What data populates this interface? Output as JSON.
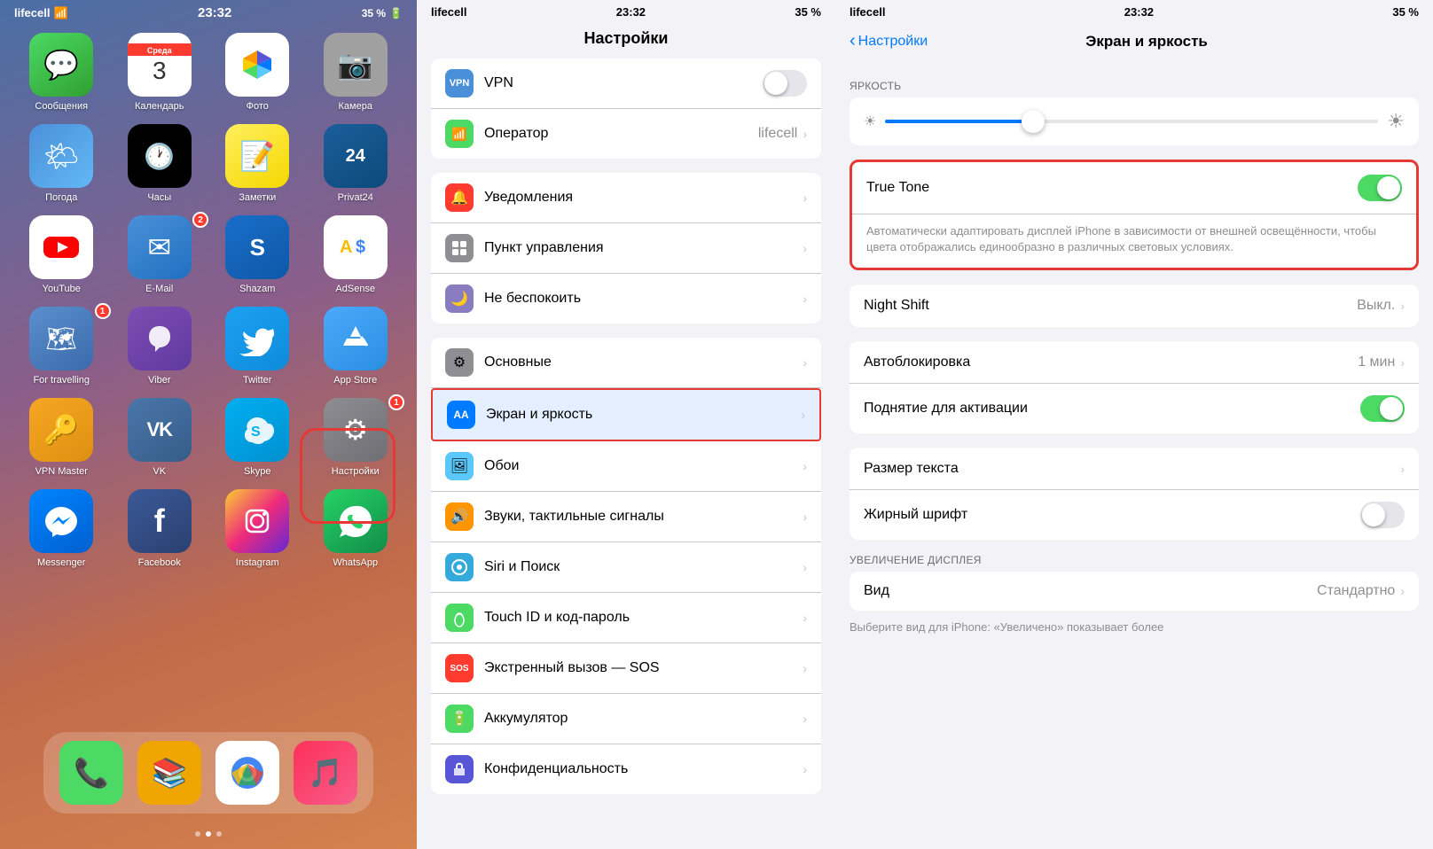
{
  "panel1": {
    "status": {
      "carrier": "lifecell",
      "signal": "📶",
      "wifi": "wifi",
      "time": "23:32",
      "battery": "35 %"
    },
    "apps_row1": [
      {
        "id": "messages",
        "label": "Сообщения",
        "icon": "💬",
        "color": "icon-messages",
        "badge": null
      },
      {
        "id": "calendar",
        "label": "Календарь",
        "icon": "cal",
        "color": "icon-calendar",
        "badge": null
      },
      {
        "id": "photos",
        "label": "Фото",
        "icon": "📷",
        "color": "icon-photos",
        "badge": null
      },
      {
        "id": "camera",
        "label": "Камера",
        "icon": "📸",
        "color": "icon-camera",
        "badge": null
      }
    ],
    "apps_row2": [
      {
        "id": "weather",
        "label": "Погода",
        "icon": "🌤",
        "color": "icon-weather",
        "badge": null
      },
      {
        "id": "clock",
        "label": "Часы",
        "icon": "🕐",
        "color": "icon-clock",
        "badge": null
      },
      {
        "id": "notes",
        "label": "Заметки",
        "icon": "📝",
        "color": "icon-notes",
        "badge": null
      },
      {
        "id": "privat24",
        "label": "Privat24",
        "icon": "24",
        "color": "icon-privat",
        "badge": null
      }
    ],
    "apps_row3": [
      {
        "id": "youtube",
        "label": "YouTube",
        "icon": "▶",
        "color": "icon-youtube",
        "badge": null
      },
      {
        "id": "email",
        "label": "E-Mail",
        "icon": "✉",
        "color": "icon-email",
        "badge": "2"
      },
      {
        "id": "shazam",
        "label": "Shazam",
        "icon": "S",
        "color": "icon-shazam",
        "badge": null
      },
      {
        "id": "adsense",
        "label": "AdSense",
        "icon": "A$",
        "color": "icon-adsense",
        "badge": null
      }
    ],
    "apps_row4": [
      {
        "id": "fortravelling",
        "label": "For travelling",
        "icon": "🗺",
        "color": "icon-fortravelling",
        "badge": "1"
      },
      {
        "id": "viber",
        "label": "Viber",
        "icon": "V",
        "color": "icon-viber",
        "badge": null
      },
      {
        "id": "twitter",
        "label": "Twitter",
        "icon": "🐦",
        "color": "icon-twitter",
        "badge": null
      },
      {
        "id": "appstore",
        "label": "App Store",
        "icon": "A",
        "color": "icon-appstore",
        "badge": null
      }
    ],
    "apps_row5": [
      {
        "id": "vpnmaster",
        "label": "VPN Master",
        "icon": "🔑",
        "color": "icon-vpnmaster",
        "badge": null
      },
      {
        "id": "vk",
        "label": "VK",
        "icon": "VK",
        "color": "icon-vk",
        "badge": null
      },
      {
        "id": "skype",
        "label": "Skype",
        "icon": "S",
        "color": "icon-skype",
        "badge": null
      },
      {
        "id": "settings",
        "label": "Настройки",
        "icon": "⚙",
        "color": "icon-settings",
        "badge": "1"
      }
    ],
    "apps_row6": [
      {
        "id": "messenger",
        "label": "Messenger",
        "icon": "M",
        "color": "icon-messenger",
        "badge": null
      },
      {
        "id": "facebook",
        "label": "Facebook",
        "icon": "f",
        "color": "icon-facebook",
        "badge": null
      },
      {
        "id": "instagram",
        "label": "Instagram",
        "icon": "📷",
        "color": "icon-instagram",
        "badge": null
      },
      {
        "id": "whatsapp",
        "label": "WhatsApp",
        "icon": "W",
        "color": "icon-whatsapp",
        "badge": null
      }
    ],
    "dock": [
      {
        "id": "phone",
        "label": "",
        "icon": "📞",
        "color": "#4cd964"
      },
      {
        "id": "books",
        "label": "",
        "icon": "📚",
        "color": "#f0a500"
      },
      {
        "id": "chrome",
        "label": "",
        "icon": "🌐",
        "color": "#4285f4"
      },
      {
        "id": "music",
        "label": "",
        "icon": "🎵",
        "color": "#fc3158"
      }
    ]
  },
  "panel2": {
    "status": {
      "carrier": "lifecell",
      "time": "23:32",
      "battery": "35 %"
    },
    "title": "Настройки",
    "rows_top": [
      {
        "id": "vpn",
        "label": "VPN",
        "icon": "VPN",
        "iconBg": "#4a90d9",
        "value": "",
        "hasToggle": true,
        "hasChevron": false
      },
      {
        "id": "carrier",
        "label": "Оператор",
        "icon": "📶",
        "iconBg": "#4cd964",
        "value": "lifecell",
        "hasChevron": true
      }
    ],
    "rows_main": [
      {
        "id": "notifications",
        "label": "Уведомления",
        "icon": "🔔",
        "iconBg": "#ff3b30",
        "value": "",
        "hasChevron": true
      },
      {
        "id": "controlcenter",
        "label": "Пункт управления",
        "icon": "⊞",
        "iconBg": "#8e8e93",
        "value": "",
        "hasChevron": true
      },
      {
        "id": "donotdisturb",
        "label": "Не беспокоить",
        "icon": "🌙",
        "iconBg": "#8a7cc0",
        "value": "",
        "hasChevron": true
      }
    ],
    "rows_main2": [
      {
        "id": "general",
        "label": "Основные",
        "icon": "⚙",
        "iconBg": "#8e8e93",
        "value": "",
        "hasChevron": true
      },
      {
        "id": "displaybright",
        "label": "Экран и яркость",
        "icon": "AA",
        "iconBg": "#007aff",
        "value": "",
        "hasChevron": true,
        "highlighted": true
      },
      {
        "id": "wallpaper",
        "label": "Обои",
        "icon": "🖼",
        "iconBg": "#5ac8fa",
        "value": "",
        "hasChevron": true
      },
      {
        "id": "sounds",
        "label": "Звуки, тактильные сигналы",
        "icon": "🔊",
        "iconBg": "#ff9500",
        "value": "",
        "hasChevron": true
      },
      {
        "id": "siri",
        "label": "Siri и Поиск",
        "icon": "◎",
        "iconBg": "#34aadc",
        "value": "",
        "hasChevron": true
      },
      {
        "id": "touchid",
        "label": "Touch ID и код-пароль",
        "icon": "👆",
        "iconBg": "#4cd964",
        "value": "",
        "hasChevron": true
      },
      {
        "id": "emergency",
        "label": "Экстренный вызов — SOS",
        "icon": "SOS",
        "iconBg": "#ff3b30",
        "value": "",
        "hasChevron": true
      },
      {
        "id": "battery",
        "label": "Аккумулятор",
        "icon": "🔋",
        "iconBg": "#4cd964",
        "value": "",
        "hasChevron": true
      },
      {
        "id": "privacy",
        "label": "Конфиденциальность",
        "icon": "🤚",
        "iconBg": "#5856d6",
        "value": "",
        "hasChevron": true
      }
    ]
  },
  "panel3": {
    "status": {
      "carrier": "lifecell",
      "time": "23:32",
      "battery": "35 %"
    },
    "backLabel": "Настройки",
    "title": "Экран и яркость",
    "brightnessSection": "ЯРКОСТЬ",
    "trueTone": {
      "label": "True Tone",
      "enabled": true,
      "description": "Автоматически адаптировать дисплей iPhone в зависимости от внешней освещённости, чтобы цвета отображались единообразно в различных световых условиях."
    },
    "nightShift": {
      "label": "Night Shift",
      "value": "Выкл."
    },
    "autolockSection": {
      "label": "Автоблокировка",
      "value": "1 мин"
    },
    "raiseSection": {
      "label": "Поднятие для активации",
      "enabled": true
    },
    "textSizeSection": {
      "label": "Размер текста"
    },
    "boldTextSection": {
      "label": "Жирный шрифт",
      "enabled": false
    },
    "zoomSection": "УВЕЛИЧЕНИЕ ДИСПЛЕЯ",
    "viewSection": {
      "label": "Вид",
      "value": "Стандартно"
    },
    "viewDesc": "Выберите вид для iPhone: «Увеличено» показывает более"
  }
}
